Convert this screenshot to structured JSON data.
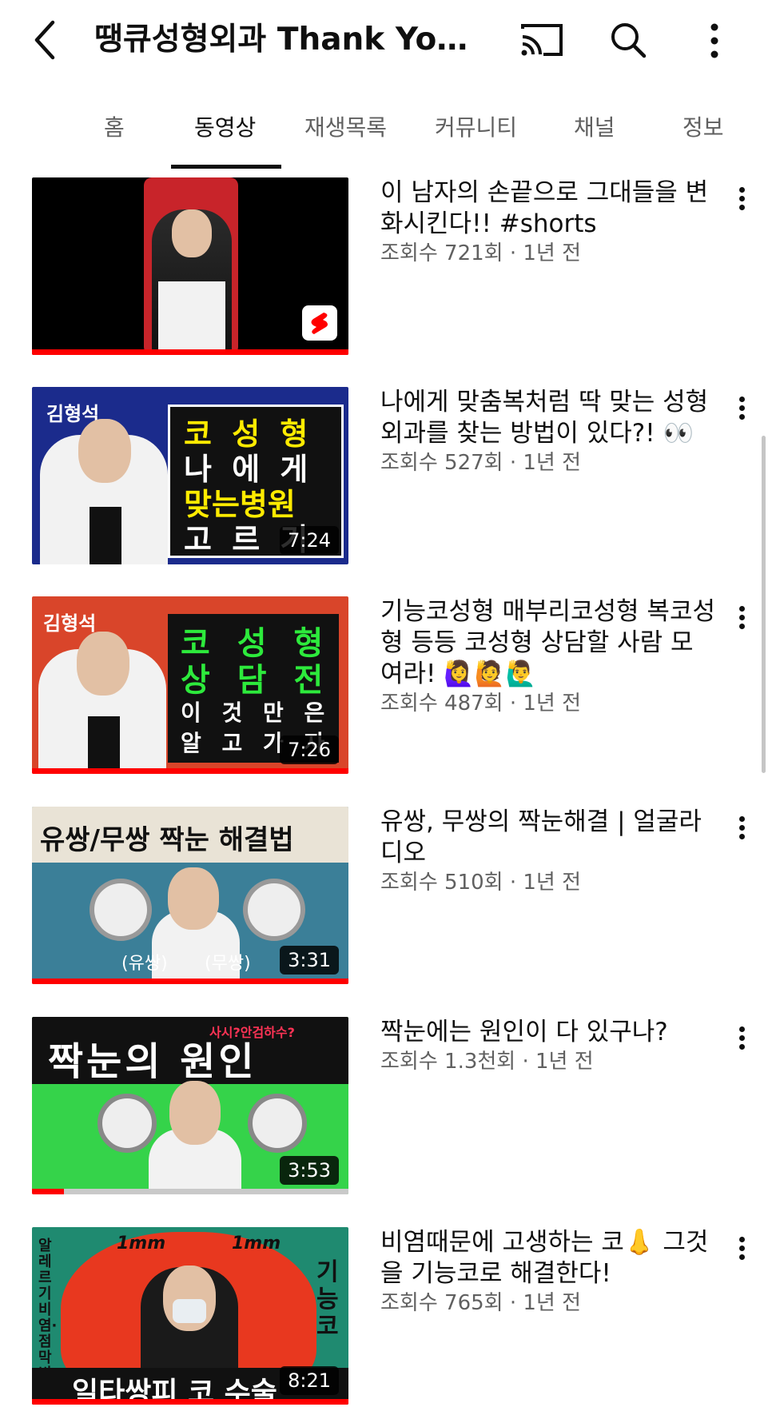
{
  "header": {
    "title": "땡큐성형외과 Thank You Plastic Surgery",
    "icons": [
      "back-icon",
      "cast-icon",
      "search-icon",
      "more-vert-icon"
    ]
  },
  "tabs": [
    {
      "label": "홈"
    },
    {
      "label": "동영상"
    },
    {
      "label": "재생목록"
    },
    {
      "label": "커뮤니티"
    },
    {
      "label": "채널"
    },
    {
      "label": "정보"
    }
  ],
  "active_tab": "동영상",
  "videos": [
    {
      "title": "이 남자의 손끝으로 그대들을 변화시킨다!! #shorts",
      "meta": "조회수 721회 · 1년 전",
      "duration": "",
      "badge": "shorts-icon",
      "progress": 1.0
    },
    {
      "title": "나에게 맞춤복처럼 딱 맞는 성형외과를 찾는 방법이 있다?! 👀",
      "meta": "조회수 527회 · 1년 전",
      "duration": "7:24",
      "thumb_text": [
        "김형석",
        "코 성 형",
        "나 에 게",
        "맞는병원",
        "고 르 기"
      ],
      "progress": 0
    },
    {
      "title": "기능코성형 매부리코성형 복코성형 등등 코성형 상담할 사람 모여라! 🙋‍♀️🙋🙋‍♂️",
      "meta": "조회수 487회 · 1년 전",
      "duration": "7:26",
      "thumb_text": [
        "김형석",
        "코 성 형",
        "상 담 전",
        "이 것 만 은",
        "알 고 가 자"
      ],
      "progress": 1.0
    },
    {
      "title": "유쌍, 무쌍의 짝눈해결 | 얼굴라디오",
      "meta": "조회수 510회 · 1년 전",
      "duration": "3:31",
      "thumb_text": [
        "유쌍/무쌍 짝눈 해결법",
        "(유쌍)",
        "(무쌍)"
      ],
      "progress": 1.0
    },
    {
      "title": "짝눈에는 원인이 다 있구나?",
      "meta": "조회수 1.3천회 · 1년 전",
      "duration": "3:53",
      "thumb_text": [
        "짝눈의 원인",
        "사시?안검하수?"
      ],
      "progress": 0.1
    },
    {
      "title": "비염때문에 고생하는 코👃 그것을 기능코로 해결한다!",
      "meta": "조회수 765회 · 1년 전",
      "duration": "8:21",
      "thumb_text": [
        "1mm",
        "1mm",
        "알레르기 비염·점막 비후",
        "기능코",
        "일타쌍피 코 수술"
      ],
      "progress": 1.0
    }
  ],
  "colors": {
    "accent": "#ff0000",
    "text_primary": "#0f0f0f",
    "text_secondary": "#606060"
  }
}
